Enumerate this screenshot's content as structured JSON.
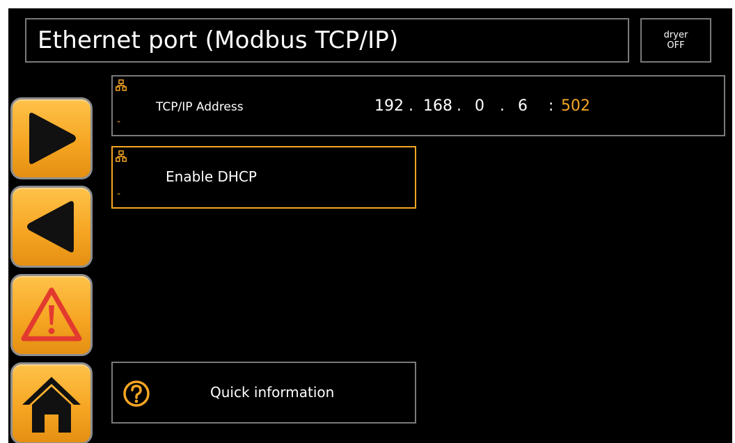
{
  "header": {
    "title": "Ethernet port (Modbus TCP/IP)",
    "status_line1": "dryer",
    "status_line2": "OFF"
  },
  "sidebar": {
    "buttons": [
      {
        "icon": "play-forward-icon"
      },
      {
        "icon": "play-back-icon"
      },
      {
        "icon": "warning-icon"
      },
      {
        "icon": "home-icon"
      }
    ]
  },
  "tcp": {
    "label": "TCP/IP Address",
    "dash": "-",
    "octets": [
      "192",
      "168",
      "0",
      "6"
    ],
    "separator": ".",
    "port_separator": ":",
    "port": "502"
  },
  "dhcp": {
    "label": "Enable DHCP",
    "dash": "-"
  },
  "quick": {
    "label": "Quick information"
  },
  "colors": {
    "accent": "#f6a623",
    "background": "#000000",
    "border": "#7a7a7a",
    "warning_red": "#e23a2e"
  }
}
